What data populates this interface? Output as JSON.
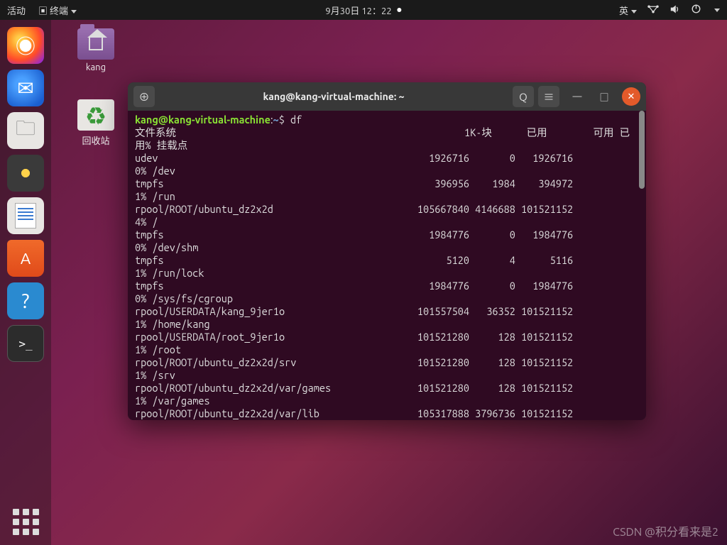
{
  "topbar": {
    "activities": "活动",
    "app_menu": "终端",
    "datetime": "9月30日 12：22",
    "ime": "英"
  },
  "desktop": {
    "home_folder": "kang",
    "trash": "回收站"
  },
  "terminal": {
    "title": "kang@kang-virtual-machine: ~",
    "prompt_user": "kang@kang-virtual-machine",
    "prompt_path": "~",
    "command": "df",
    "header": {
      "fs": "文件系统",
      "blocks": "1K-块",
      "used": "已用",
      "avail": "可用",
      "usep": "已",
      "use_label": "用%",
      "mount": "挂载点"
    },
    "rows": [
      {
        "fs": "udev",
        "blocks": "1926716",
        "used": "0",
        "avail": "1926716",
        "usep": "0%",
        "mount": "/dev"
      },
      {
        "fs": "tmpfs",
        "blocks": "396956",
        "used": "1984",
        "avail": "394972",
        "usep": "1%",
        "mount": "/run"
      },
      {
        "fs": "rpool/ROOT/ubuntu_dz2x2d",
        "blocks": "105667840",
        "used": "4146688",
        "avail": "101521152",
        "usep": "4%",
        "mount": "/"
      },
      {
        "fs": "tmpfs",
        "blocks": "1984776",
        "used": "0",
        "avail": "1984776",
        "usep": "0%",
        "mount": "/dev/shm"
      },
      {
        "fs": "tmpfs",
        "blocks": "5120",
        "used": "4",
        "avail": "5116",
        "usep": "1%",
        "mount": "/run/lock"
      },
      {
        "fs": "tmpfs",
        "blocks": "1984776",
        "used": "0",
        "avail": "1984776",
        "usep": "0%",
        "mount": "/sys/fs/cgroup"
      },
      {
        "fs": "rpool/USERDATA/kang_9jer1o",
        "blocks": "101557504",
        "used": "36352",
        "avail": "101521152",
        "usep": "1%",
        "mount": "/home/kang"
      },
      {
        "fs": "rpool/USERDATA/root_9jer1o",
        "blocks": "101521280",
        "used": "128",
        "avail": "101521152",
        "usep": "1%",
        "mount": "/root"
      },
      {
        "fs": "rpool/ROOT/ubuntu_dz2x2d/srv",
        "blocks": "101521280",
        "used": "128",
        "avail": "101521152",
        "usep": "1%",
        "mount": "/srv"
      },
      {
        "fs": "rpool/ROOT/ubuntu_dz2x2d/var/games",
        "blocks": "101521280",
        "used": "128",
        "avail": "101521152",
        "usep": "1%",
        "mount": "/var/games"
      },
      {
        "fs": "rpool/ROOT/ubuntu_dz2x2d/var/lib",
        "blocks": "105317888",
        "used": "3796736",
        "avail": "101521152",
        "usep": "",
        "mount": ""
      }
    ]
  },
  "watermark": "CSDN @积分看来是2"
}
